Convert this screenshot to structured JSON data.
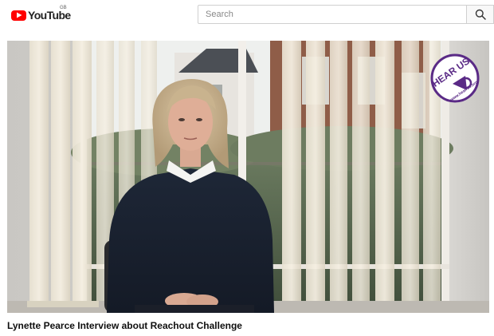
{
  "header": {
    "logo_text": "YouTube",
    "logo_region": "GB",
    "logo_icon": "youtube-play-icon",
    "brand_color": "#ff0000"
  },
  "search": {
    "placeholder": "Search",
    "value": "",
    "button_icon": "search-icon"
  },
  "video": {
    "title": "Lynette Pearce Interview about Reachout Challenge",
    "watermark": {
      "main_text": "HEAR US",
      "url_text": "www.hear-us.org",
      "color": "#5a2a86"
    }
  }
}
